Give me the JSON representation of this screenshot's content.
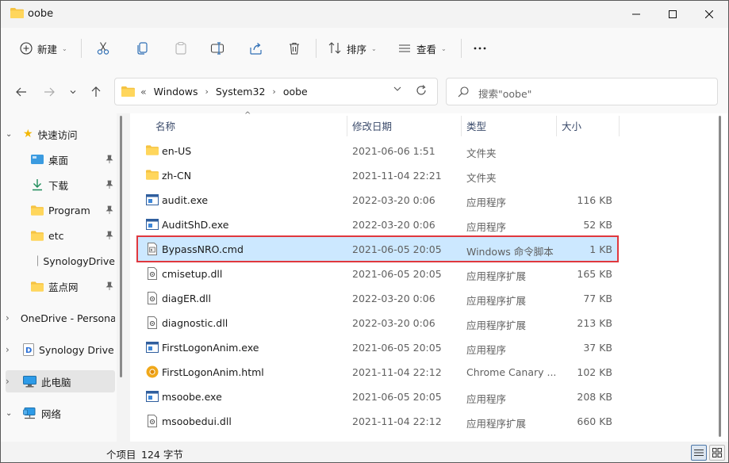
{
  "window": {
    "title": "oobe"
  },
  "toolbar": {
    "new_label": "新建",
    "sort_label": "排序",
    "view_label": "查看"
  },
  "address": {
    "overflow": "«",
    "crumbs": [
      "Windows",
      "System32",
      "oobe"
    ]
  },
  "search": {
    "placeholder": "搜索\"oobe\""
  },
  "sidebar": {
    "items": [
      {
        "label": "快速访问"
      },
      {
        "label": "桌面"
      },
      {
        "label": "下载"
      },
      {
        "label": "Program"
      },
      {
        "label": "etc"
      },
      {
        "label": "SynologyDrive"
      },
      {
        "label": "蓝点网"
      },
      {
        "label": "OneDrive - Personal"
      },
      {
        "label": "Synology Drive"
      },
      {
        "label": "此电脑"
      },
      {
        "label": "网络"
      }
    ]
  },
  "columns": {
    "name": "名称",
    "date": "修改日期",
    "type": "类型",
    "size": "大小"
  },
  "files": [
    {
      "name": "en-US",
      "date": "2021-06-06 1:51",
      "type": "文件夹",
      "size": "",
      "icon": "folder-icon"
    },
    {
      "name": "zh-CN",
      "date": "2021-11-04 22:21",
      "type": "文件夹",
      "size": "",
      "icon": "folder-icon"
    },
    {
      "name": "audit.exe",
      "date": "2022-03-20 0:06",
      "type": "应用程序",
      "size": "116 KB",
      "icon": "exe-icon"
    },
    {
      "name": "AuditShD.exe",
      "date": "2022-03-20 0:06",
      "type": "应用程序",
      "size": "52 KB",
      "icon": "exe-icon"
    },
    {
      "name": "BypassNRO.cmd",
      "date": "2021-06-05 20:05",
      "type": "Windows 命令脚本",
      "size": "1 KB",
      "icon": "cmd-icon"
    },
    {
      "name": "cmisetup.dll",
      "date": "2021-06-05 20:05",
      "type": "应用程序扩展",
      "size": "165 KB",
      "icon": "dll-icon"
    },
    {
      "name": "diagER.dll",
      "date": "2022-03-20 0:06",
      "type": "应用程序扩展",
      "size": "77 KB",
      "icon": "dll-icon"
    },
    {
      "name": "diagnostic.dll",
      "date": "2022-03-20 0:06",
      "type": "应用程序扩展",
      "size": "213 KB",
      "icon": "dll-icon"
    },
    {
      "name": "FirstLogonAnim.exe",
      "date": "2021-06-05 20:05",
      "type": "应用程序",
      "size": "37 KB",
      "icon": "exe-icon"
    },
    {
      "name": "FirstLogonAnim.html",
      "date": "2021-11-04 22:12",
      "type": "Chrome Canary ...",
      "size": "102 KB",
      "icon": "chrome-canary-icon"
    },
    {
      "name": "msoobe.exe",
      "date": "2021-06-05 20:05",
      "type": "应用程序",
      "size": "208 KB",
      "icon": "exe-icon"
    },
    {
      "name": "msoobedui.dll",
      "date": "2021-11-04 22:12",
      "type": "应用程序扩展",
      "size": "660 KB",
      "icon": "dll-icon"
    }
  ],
  "status": {
    "count": "个项目",
    "size": "124 字节"
  },
  "colors": {
    "selection": "#cce8ff",
    "highlight_border": "#e0383e",
    "folder": "#f5c342"
  }
}
